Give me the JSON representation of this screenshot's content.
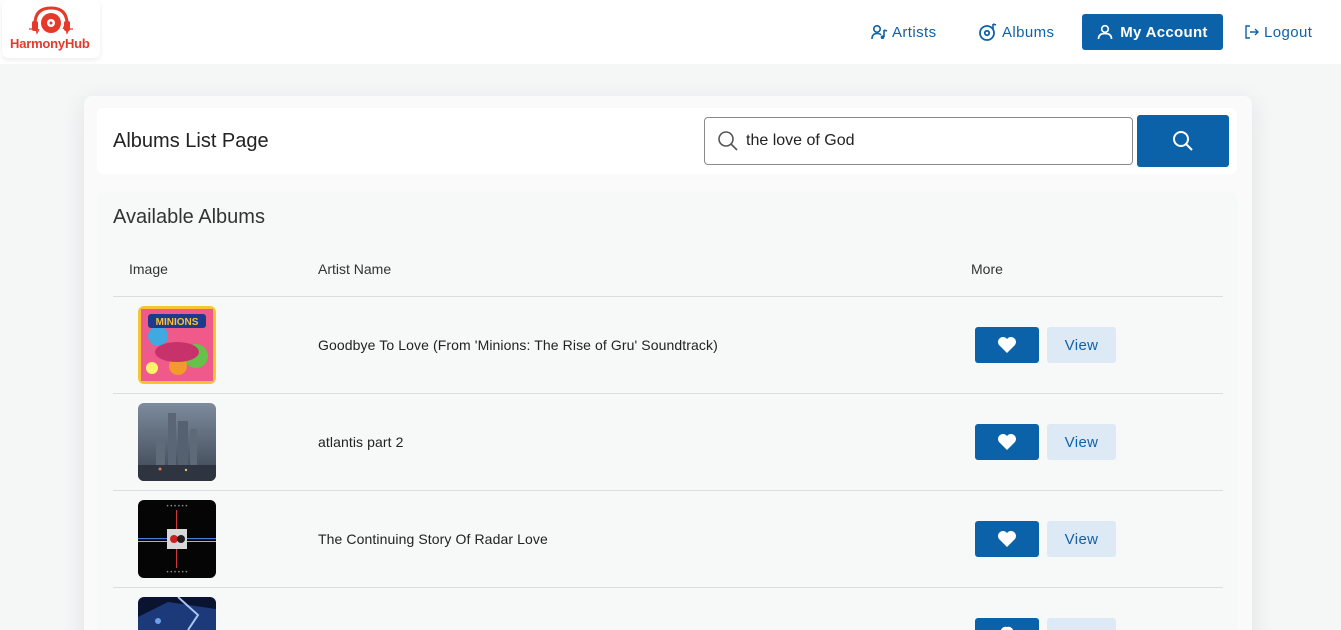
{
  "app": {
    "logo_text": "HarmonyHub"
  },
  "nav": {
    "artists_label": "Artists",
    "albums_label": "Albums",
    "account_label": "My Account",
    "logout_label": "Logout"
  },
  "page": {
    "title": "Albums List Page",
    "search_value": "the love of God",
    "section_title": "Available Albums"
  },
  "table": {
    "headers": [
      "Image",
      "Artist Name",
      "More"
    ],
    "rows": [
      {
        "name": "Goodbye To Love (From 'Minions: The Rise of Gru' Soundtrack)",
        "view_label": "View",
        "art": "minions-cover"
      },
      {
        "name": "atlantis part 2",
        "view_label": "View",
        "art": "foggy-city-cover"
      },
      {
        "name": "The Continuing Story Of Radar Love",
        "view_label": "View",
        "art": "radar-love-cover"
      },
      {
        "name": "",
        "view_label": "",
        "art": "dark-blue-cover"
      }
    ]
  },
  "colors": {
    "primary": "#0b62a8",
    "logo_red": "#e53a2a",
    "view_bg": "#dde9f4"
  }
}
